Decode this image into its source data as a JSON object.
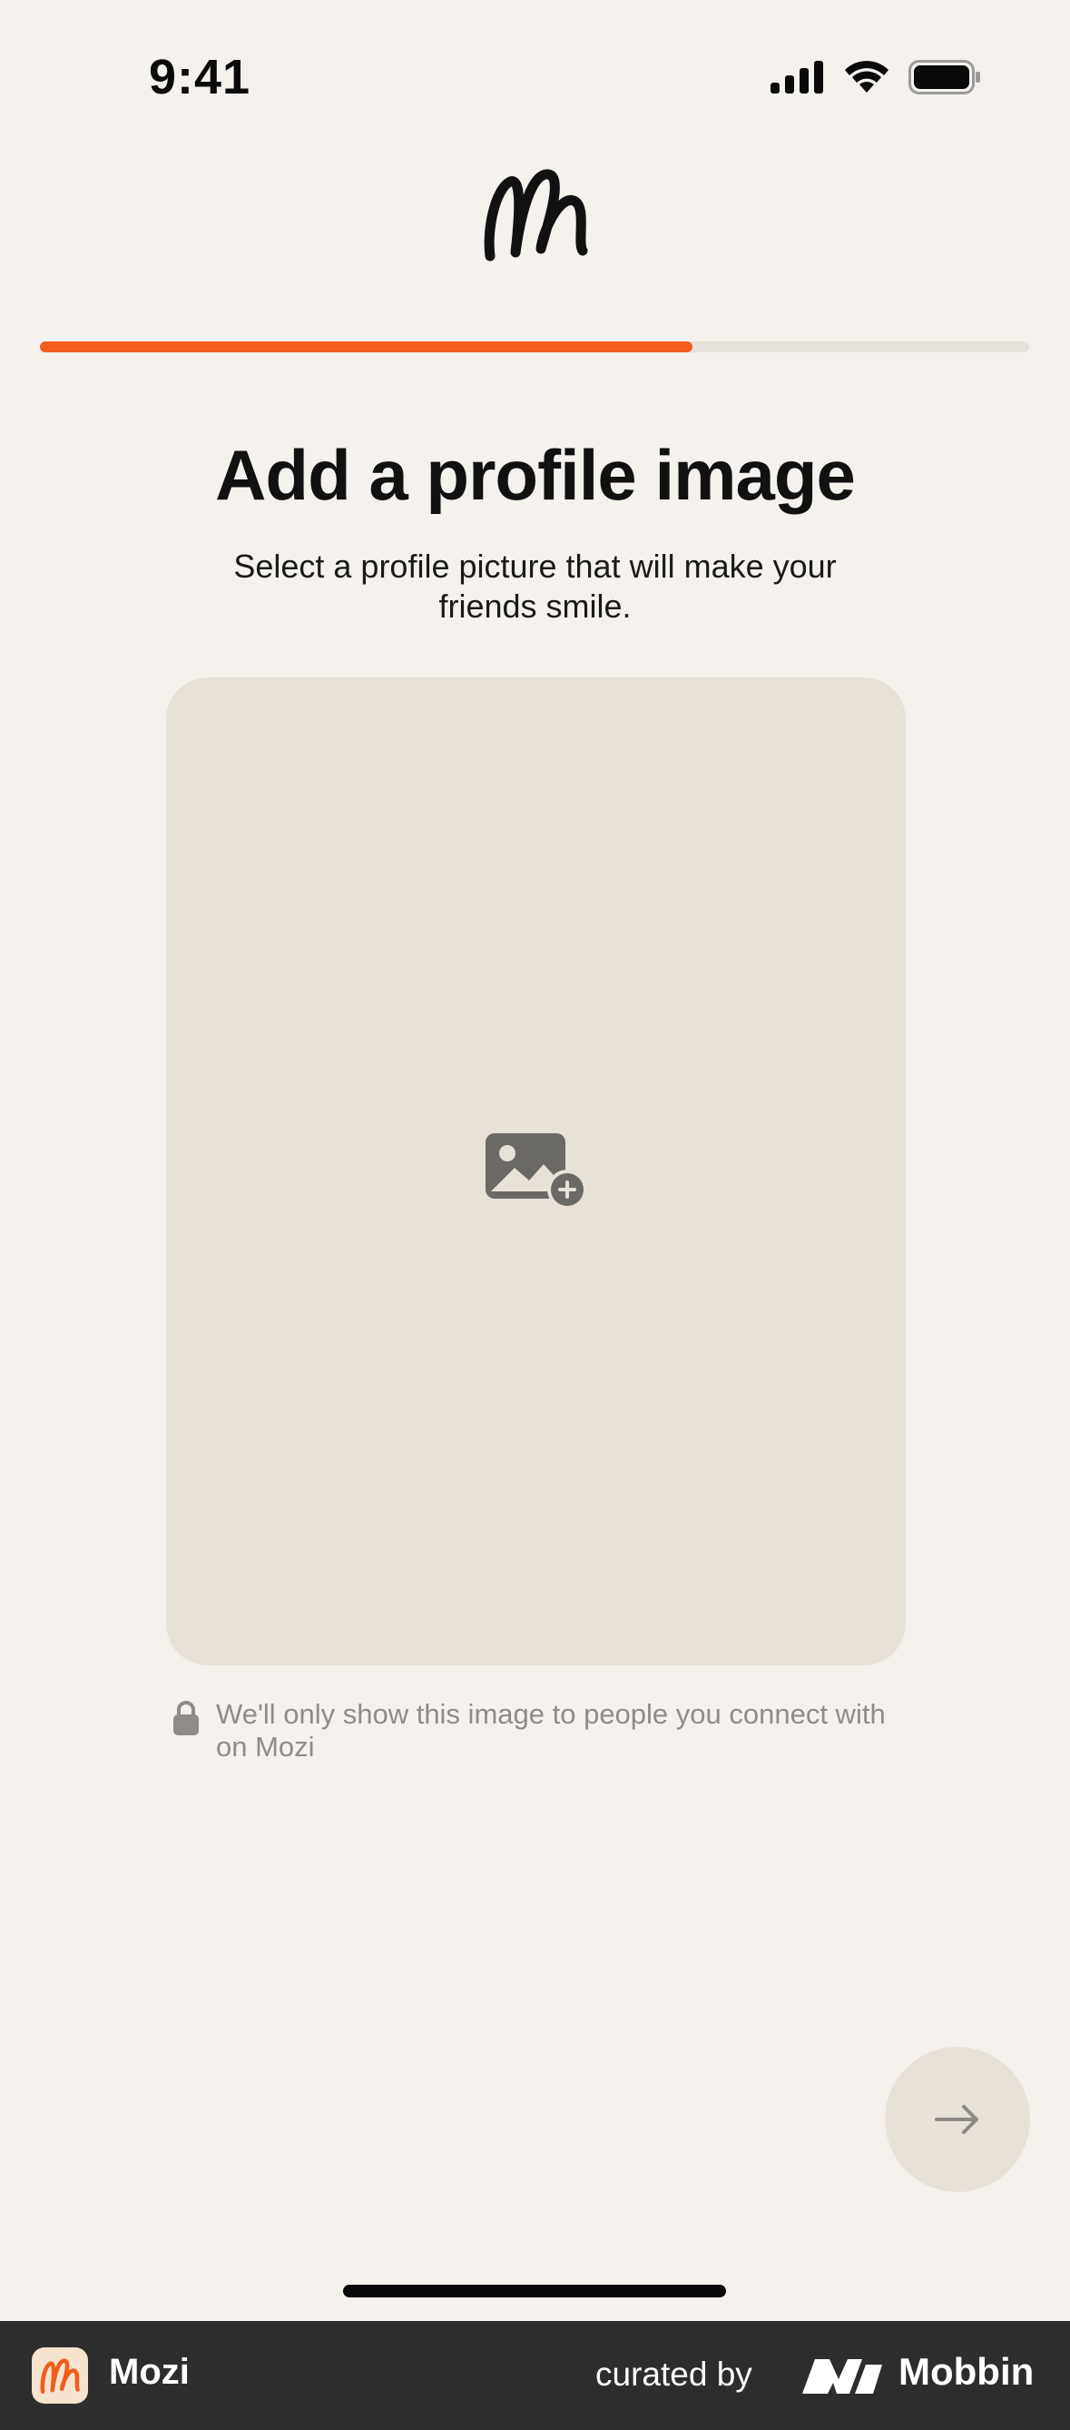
{
  "status_bar": {
    "time": "9:41",
    "icons": [
      "cellular-signal-icon",
      "wifi-icon",
      "battery-icon"
    ]
  },
  "header": {
    "logo_icon": "mozi-logo-icon"
  },
  "progress": {
    "fraction": 0.66,
    "fill_color": "#f25d1b",
    "track_color": "#e6e1da"
  },
  "main": {
    "title": "Add a profile image",
    "subtitle": "Select a profile picture that will make your friends smile.",
    "image_picker": {
      "icon": "add-photo-icon",
      "background": "#e8e1d8"
    },
    "privacy_note": {
      "icon": "lock-icon",
      "text": "We'll only show this image to people you connect with on Mozi"
    },
    "next_button": {
      "icon": "arrow-right-icon"
    }
  },
  "footer": {
    "app_icon": "mozi-app-icon",
    "app_name": "Mozi",
    "curated_label": "curated by",
    "brand_icon": "mobbin-logo-icon",
    "brand_name": "Mobbin"
  }
}
